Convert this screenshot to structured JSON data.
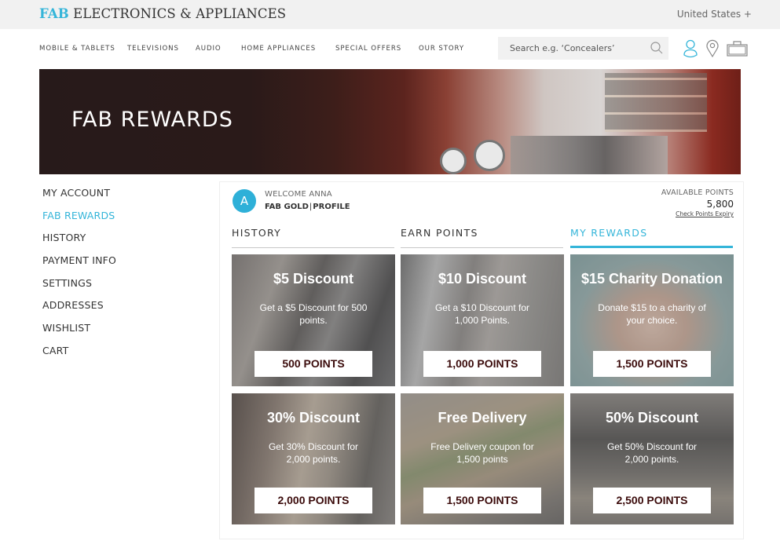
{
  "header": {
    "brand_highlight": "FAB",
    "brand_rest": " ELECTRONICS & APPLIANCES",
    "country": "United States +"
  },
  "nav": {
    "items": [
      "MOBILE & TABLETS",
      "TELEVISIONS",
      "AUDIO",
      "HOME APPLIANCES",
      "SPECIAL OFFERS",
      "OUR STORY"
    ],
    "search_placeholder": "Search e.g. ‘Concealers’",
    "icons": [
      "search-icon",
      "user-icon",
      "location-pin-icon",
      "bag-icon"
    ]
  },
  "hero": {
    "title": "FAB REWARDS"
  },
  "sidebar": {
    "items": [
      {
        "label": "MY ACCOUNT",
        "active": false
      },
      {
        "label": "FAB REWARDS",
        "active": true
      },
      {
        "label": "HISTORY",
        "active": false
      },
      {
        "label": "PAYMENT INFO",
        "active": false
      },
      {
        "label": "SETTINGS",
        "active": false
      },
      {
        "label": "ADDRESSES",
        "active": false
      },
      {
        "label": "WISHLIST",
        "active": false
      },
      {
        "label": "CART",
        "active": false
      }
    ]
  },
  "account": {
    "avatar_initial": "A",
    "welcome": "WELCOME ANNA",
    "tier": "FAB GOLD",
    "separator": "|",
    "profile_link": "PROFILE",
    "available_label": "AVAILABLE POINTS",
    "available_points": "5,800",
    "expiry_link": "Check Points Expiry"
  },
  "tabs": [
    {
      "label": "HISTORY",
      "active": false
    },
    {
      "label": "EARN POINTS",
      "active": false
    },
    {
      "label": "MY REWARDS",
      "active": true
    }
  ],
  "rewards": [
    {
      "title": "$5 Discount",
      "desc": "Get a $5 Discount for 500 points.",
      "points": "500 POINTS"
    },
    {
      "title": "$10 Discount",
      "desc": "Get a $10 Discount for 1,000 Points.",
      "points": "1,000 POINTS"
    },
    {
      "title": "$15 Charity Donation",
      "desc": "Donate $15 to a charity of your choice.",
      "points": "1,500 POINTS"
    },
    {
      "title": "30% Discount",
      "desc": "Get 30% Discount for 2,000 points.",
      "points": "2,000 POINTS"
    },
    {
      "title": "Free Delivery",
      "desc": "Free Delivery coupon for 1,500 points",
      "points": "1,500 POINTS"
    },
    {
      "title": "50% Discount",
      "desc": "Get 50% Discount for 2,000 points.",
      "points": "2,500 POINTS"
    }
  ],
  "colors": {
    "accent": "#34b5d9",
    "points_text": "#3b0b0b",
    "hero_dark": "#271a1a"
  }
}
